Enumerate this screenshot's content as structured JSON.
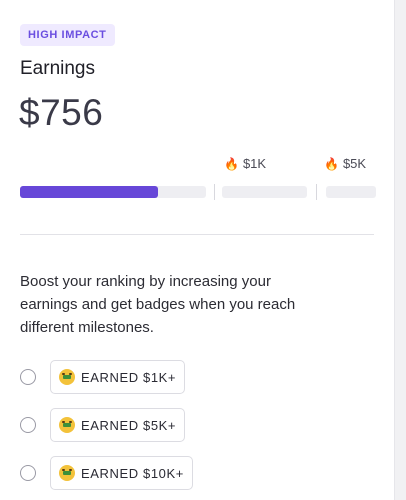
{
  "header": {
    "impact_badge": "HIGH IMPACT",
    "title": "Earnings",
    "amount": "$756"
  },
  "progress": {
    "current_value": 756,
    "milestones": [
      {
        "icon": "fire-icon",
        "label": "$1K",
        "value": 1000
      },
      {
        "icon": "fire-icon",
        "label": "$5K",
        "value": 5000
      }
    ],
    "segment_fill_fraction": [
      0.74,
      0,
      0
    ]
  },
  "description": "Boost your ranking by increasing your earnings and get badges when you reach different milestones.",
  "badges": [
    {
      "icon": "money-face-icon",
      "label": "EARNED $1K+"
    },
    {
      "icon": "money-face-icon",
      "label": "EARNED $5K+"
    },
    {
      "icon": "money-face-icon",
      "label": "EARNED $10K+"
    }
  ],
  "colors": {
    "accent": "#6747d8",
    "impact_badge_bg": "#efeaff",
    "impact_badge_text": "#6a4ee0",
    "track": "#eeeef2",
    "fire": "#e8591a"
  }
}
